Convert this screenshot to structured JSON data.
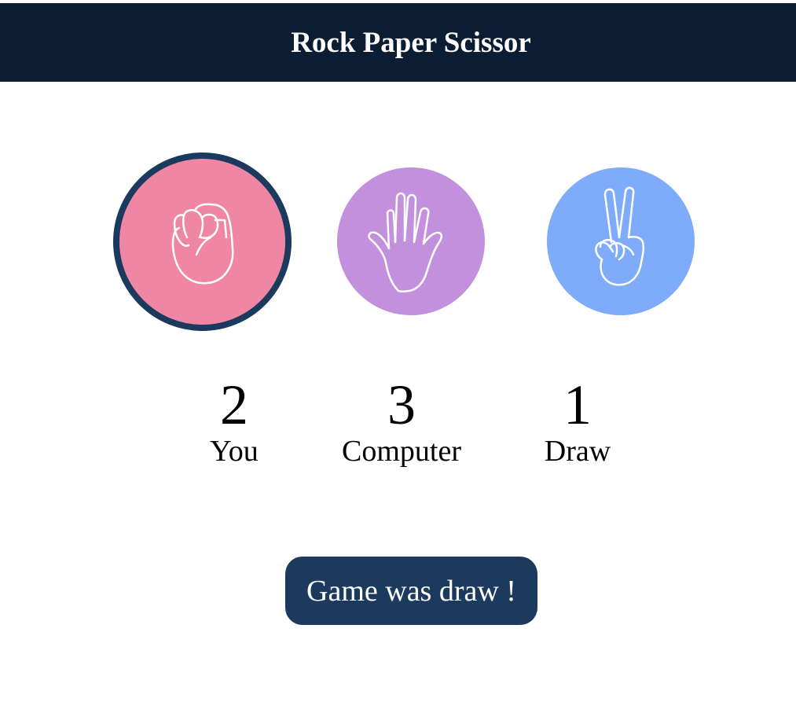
{
  "header": {
    "title": "Rock Paper Scissor"
  },
  "choices": [
    {
      "name": "rock",
      "color": "#ef86a3",
      "selected": true,
      "icon": "fist-icon"
    },
    {
      "name": "paper",
      "color": "#c290dc",
      "selected": false,
      "icon": "open-hand-icon"
    },
    {
      "name": "scissor",
      "color": "#7fabfb",
      "selected": false,
      "icon": "peace-hand-icon"
    }
  ],
  "scores": {
    "you": {
      "value": "2",
      "label": "You"
    },
    "computer": {
      "value": "3",
      "label": "Computer"
    },
    "draw": {
      "value": "1",
      "label": "Draw"
    }
  },
  "result": {
    "message": "Game was draw !"
  },
  "colors": {
    "header_bg": "#0a1d33",
    "accent": "#1c3a5e"
  }
}
